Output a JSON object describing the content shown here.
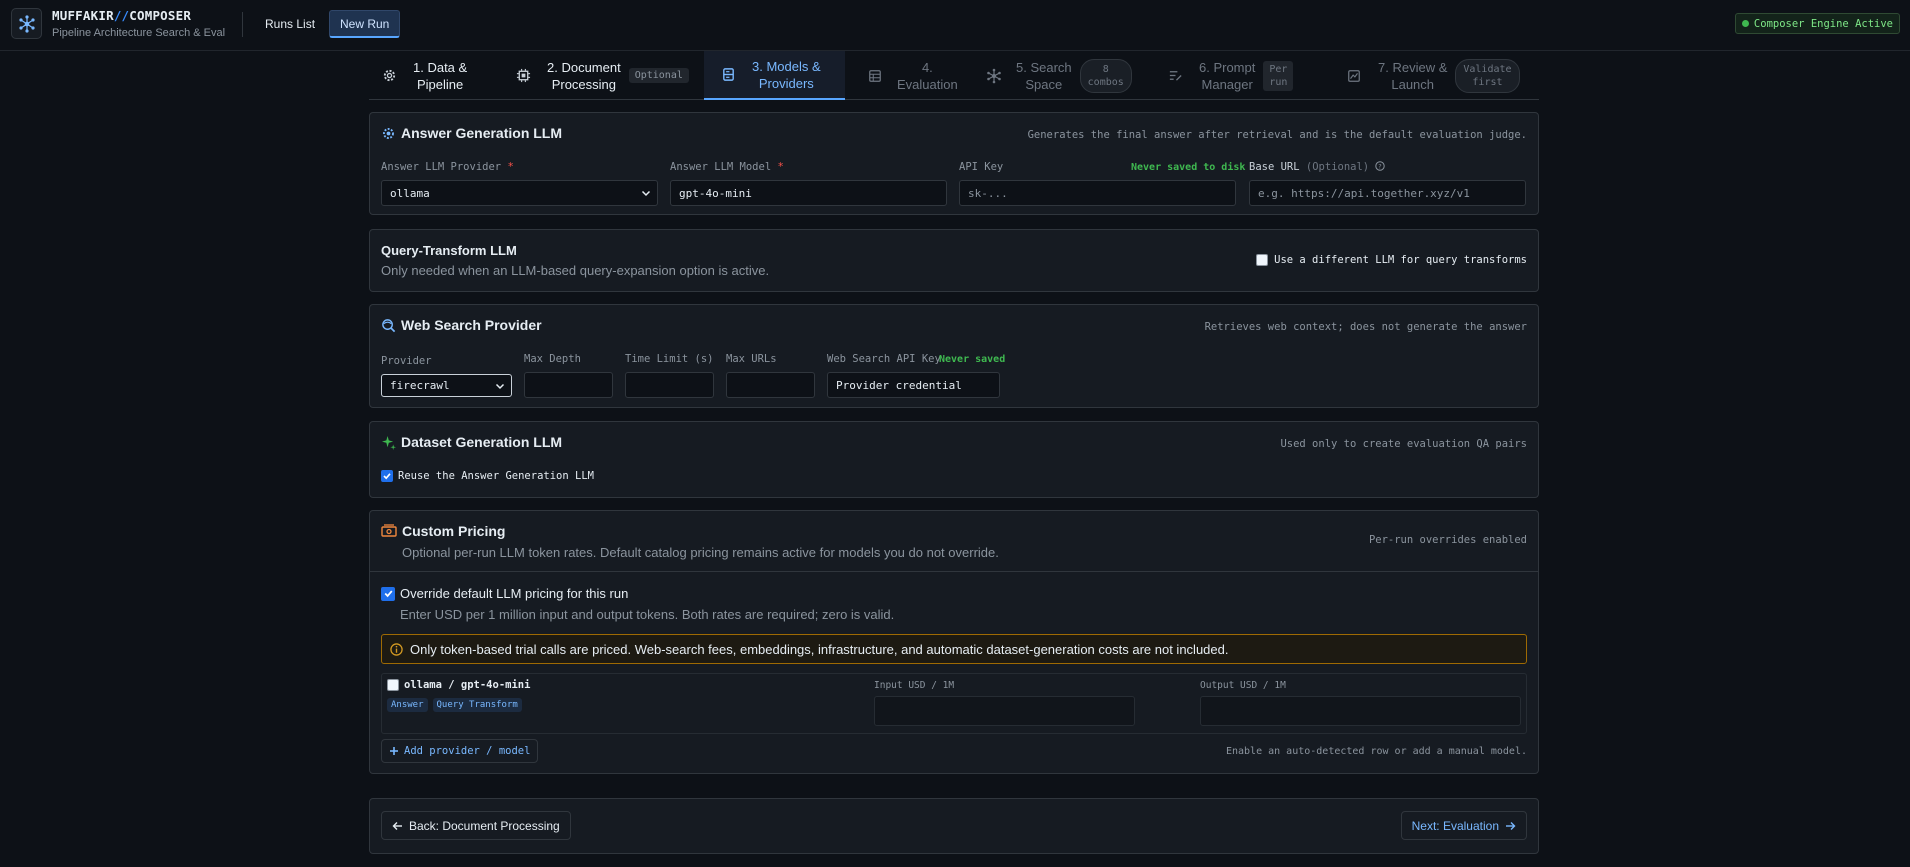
{
  "app": {
    "brand_left": "MUFFAKIR",
    "brand_sep": "//",
    "brand_right": "COMPOSER",
    "subtitle": "Pipeline Architecture Search & Eval",
    "nav": {
      "runs_list": "Runs List",
      "new_run": "New Run"
    },
    "engine_status": "Composer Engine Active"
  },
  "steps": [
    {
      "label_l1": "1. Data &",
      "label_l2": "Pipeline",
      "state": "done"
    },
    {
      "label_l1": "2. Document",
      "label_l2": "Processing",
      "badge": "Optional",
      "state": "done"
    },
    {
      "label_l1": "3. Models &",
      "label_l2": "Providers",
      "state": "active"
    },
    {
      "label_l1": "4.",
      "label_l2": "Evaluation",
      "state": "disabled"
    },
    {
      "label_l1": "5. Search",
      "label_l2": "Space",
      "badge_l1": "8",
      "badge_l2": "combos",
      "state": "disabled"
    },
    {
      "label_l1": "6. Prompt",
      "label_l2": "Manager",
      "badge_l1": "Per",
      "badge_l2": "run",
      "state": "disabled"
    },
    {
      "label_l1": "7. Review &",
      "label_l2": "Launch",
      "badge_l1": "Validate",
      "badge_l2": "first",
      "state": "disabled"
    }
  ],
  "answer_llm": {
    "title": "Answer Generation LLM",
    "note": "Generates the final answer after retrieval and is the default evaluation judge.",
    "provider_label": "Answer LLM Provider",
    "provider_value": "ollama",
    "model_label": "Answer LLM Model",
    "model_value": "gpt-4o-mini",
    "api_key_label": "API Key",
    "api_key_note": "Never saved to disk",
    "api_key_placeholder": "sk-...",
    "base_url_label": "Base URL",
    "base_url_optional": "(Optional)",
    "base_url_placeholder": "e.g. https://api.together.xyz/v1"
  },
  "query_transform": {
    "title": "Query-Transform LLM",
    "desc": "Only needed when an LLM-based query-expansion option is active.",
    "checkbox_label": "Use a different LLM for query transforms",
    "checked": false
  },
  "web_search": {
    "title": "Web Search Provider",
    "note": "Retrieves web context; does not generate the answer",
    "provider_label": "Provider",
    "provider_value": "firecrawl",
    "max_depth_label": "Max Depth",
    "time_limit_label": "Time Limit (s)",
    "max_urls_label": "Max URLs",
    "api_key_label": "Web Search API Key",
    "api_key_note": "Never saved",
    "api_key_placeholder": "Provider credential"
  },
  "dataset_llm": {
    "title": "Dataset Generation LLM",
    "note": "Used only to create evaluation QA pairs",
    "reuse_label": "Reuse the Answer Generation LLM",
    "reuse_checked": true
  },
  "pricing": {
    "title": "Custom Pricing",
    "desc": "Optional per-run LLM token rates. Default catalog pricing remains active for models you do not override.",
    "note": "Per-run overrides enabled",
    "override_label": "Override default LLM pricing for this run",
    "override_checked": true,
    "override_help": "Enter USD per 1 million input and output tokens. Both rates are required; zero is valid.",
    "warning": "Only token-based trial calls are priced. Web-search fees, embeddings, infrastructure, and automatic dataset-generation costs are not included.",
    "row": {
      "model": "ollama / gpt-4o-mini",
      "tags": [
        "Answer",
        "Query Transform"
      ],
      "input_label": "Input USD / 1M",
      "output_label": "Output USD / 1M",
      "checked": false
    },
    "add_button": "Add provider / model",
    "footer_note": "Enable an auto-detected row or add a manual model."
  },
  "footer": {
    "back": "Back: Document Processing",
    "next": "Next: Evaluation"
  },
  "colors": {
    "accent": "#58a6ff",
    "success": "#3fb950",
    "warning_border": "#9e6a03",
    "danger": "#f85149"
  }
}
